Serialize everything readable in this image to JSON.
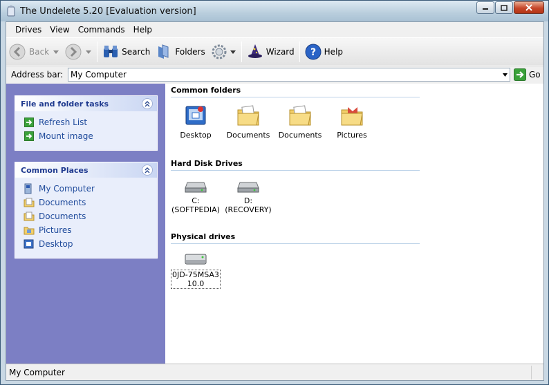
{
  "window": {
    "title": "The Undelete 5.20 [Evaluation version]"
  },
  "menu": [
    "Drives",
    "View",
    "Commands",
    "Help"
  ],
  "toolbar": {
    "back": "Back",
    "search": "Search",
    "folders": "Folders",
    "wizard": "Wizard",
    "help": "Help"
  },
  "address": {
    "label": "Address bar:",
    "value": "My Computer",
    "go": "Go"
  },
  "tasks": {
    "title": "File and folder tasks",
    "items": [
      "Refresh List",
      "Mount image"
    ]
  },
  "places": {
    "title": "Common Places",
    "items": [
      "My Computer",
      "Documents",
      "Documents",
      "Pictures",
      "Desktop"
    ]
  },
  "common_folders": {
    "title": "Common folders",
    "items": [
      "Desktop",
      "Documents",
      "Documents",
      "Pictures"
    ]
  },
  "hard_disks": {
    "title": "Hard Disk Drives",
    "items": [
      {
        "line1": "C:",
        "line2": "(SOFTPEDIA)"
      },
      {
        "line1": "D:",
        "line2": "(RECOVERY)"
      }
    ]
  },
  "physical": {
    "title": "Physical drives",
    "items": [
      {
        "line1": "0JD-75MSA3",
        "line2": "10.0"
      }
    ]
  },
  "status": {
    "text": "My Computer"
  },
  "colors": {
    "leftpane": "#7c7fc4",
    "link": "#214c9c",
    "section_rule": "#bcd2e8"
  }
}
